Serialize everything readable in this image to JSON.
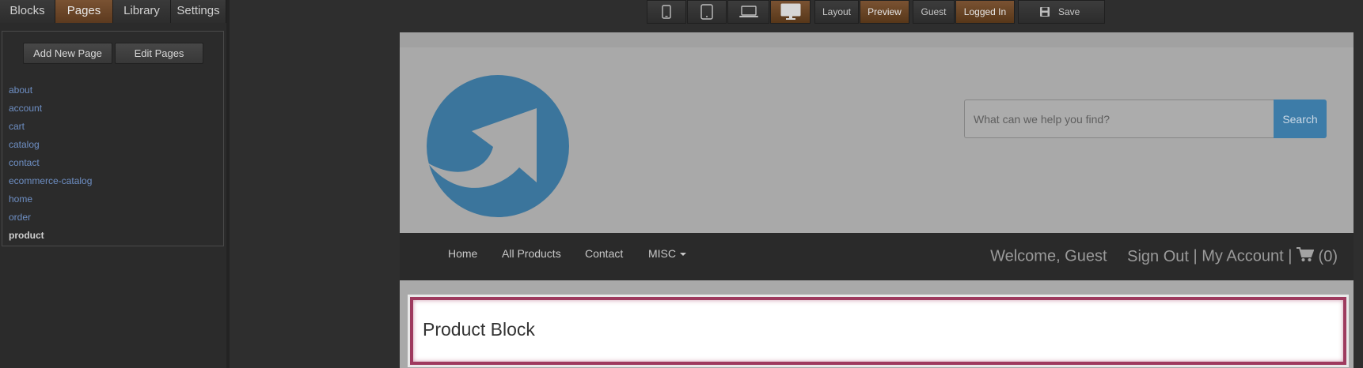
{
  "left_panel": {
    "tabs": [
      {
        "label": "Blocks"
      },
      {
        "label": "Pages"
      },
      {
        "label": "Library"
      },
      {
        "label": "Settings"
      }
    ],
    "add_page_label": "Add New Page",
    "edit_pages_label": "Edit Pages",
    "pages": [
      "about",
      "account",
      "cart",
      "catalog",
      "contact",
      "ecommerce-catalog",
      "home",
      "order",
      "product"
    ],
    "current_page": "product"
  },
  "toolbar": {
    "devices": [
      "phone-icon",
      "tablet-icon",
      "laptop-icon",
      "desktop-icon"
    ],
    "active_device": "desktop-icon",
    "layout_label": "Layout",
    "preview_label": "Preview",
    "guest_label": "Guest",
    "logged_in_label": "Logged In",
    "save_label": "Save",
    "save_icon": "floppy-disk-icon"
  },
  "canvas": {
    "logo": "logo-arrow-icon",
    "search": {
      "placeholder": "What can we help you find?",
      "button_label": "Search"
    },
    "nav": {
      "home": "Home",
      "all_products": "All Products",
      "contact": "Contact",
      "misc": "MISC",
      "welcome": "Welcome, Guest",
      "sign_out": "Sign Out",
      "separator": "|",
      "my_account": "My Account",
      "cart_icon": "cart-icon",
      "cart_count": "(0)"
    },
    "product_block_title": "Product Block"
  },
  "colors": {
    "accent_tab": "#6b4526",
    "search_button": "#3d7ca8",
    "logo_blue": "#3b759c",
    "block_border": "#9e3a5e",
    "link": "#6e8fc4"
  }
}
